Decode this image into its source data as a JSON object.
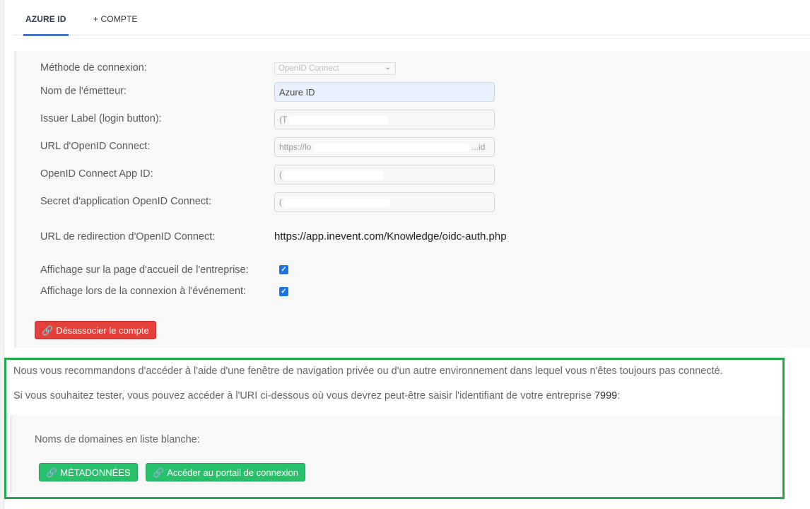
{
  "tabs": [
    {
      "label": "AZURE ID",
      "active": true
    },
    {
      "label": "+ COMPTE",
      "active": false
    }
  ],
  "form": {
    "method": {
      "label": "Méthode de connexion:",
      "value": "OpenID Connect"
    },
    "issuer_name": {
      "label": "Nom de l'émetteur:",
      "value": "Azure ID"
    },
    "issuer_label": {
      "label": "Issuer Label (login button):",
      "value": "(T"
    },
    "oidc_url": {
      "label": "URL d'OpenID Connect:",
      "value_start": "https://lo",
      "value_end": "...id"
    },
    "app_id": {
      "label": "OpenID Connect App ID:",
      "value": "("
    },
    "app_secret": {
      "label": "Secret d'application OpenID Connect:",
      "value": "("
    },
    "redirect_url": {
      "label": "URL de redirection d'OpenID Connect:",
      "value": "https://app.inevent.com/Knowledge/oidc-auth.php"
    },
    "show_company_home": {
      "label": "Affichage sur la page d'accueil de l'entreprise:",
      "checked": true
    },
    "show_event_login": {
      "label": "Affichage lors de la connexion à l'événement:",
      "checked": true
    }
  },
  "buttons": {
    "unlink": "Désassocier le compte",
    "metadata": "MÉTADONNÉES",
    "login_portal": "Accéder au portail de connexion"
  },
  "info": {
    "line1": "Nous vous recommandons d'accéder à l'aide d'une fenêtre de navigation privée ou d'un autre environnement dans lequel vous n'êtes toujours pas connecté.",
    "line2_prefix": "Si vous souhaitez tester, vous pouvez accéder à l'URI ci-dessous où vous devrez peut-être saisir l'identifiant de votre entreprise ",
    "company_id": "7999",
    "line2_suffix": ":",
    "whitelist_label": "Noms de domaines en liste blanche:"
  },
  "icons": {
    "link": "🔗",
    "chevron": "⌄",
    "check": "✓"
  },
  "colors": {
    "tab_accent": "#4a72c4",
    "danger": "#e5413b",
    "success": "#27c16b",
    "highlight_border": "#1fab4a",
    "checkbox": "#1a73e8"
  }
}
